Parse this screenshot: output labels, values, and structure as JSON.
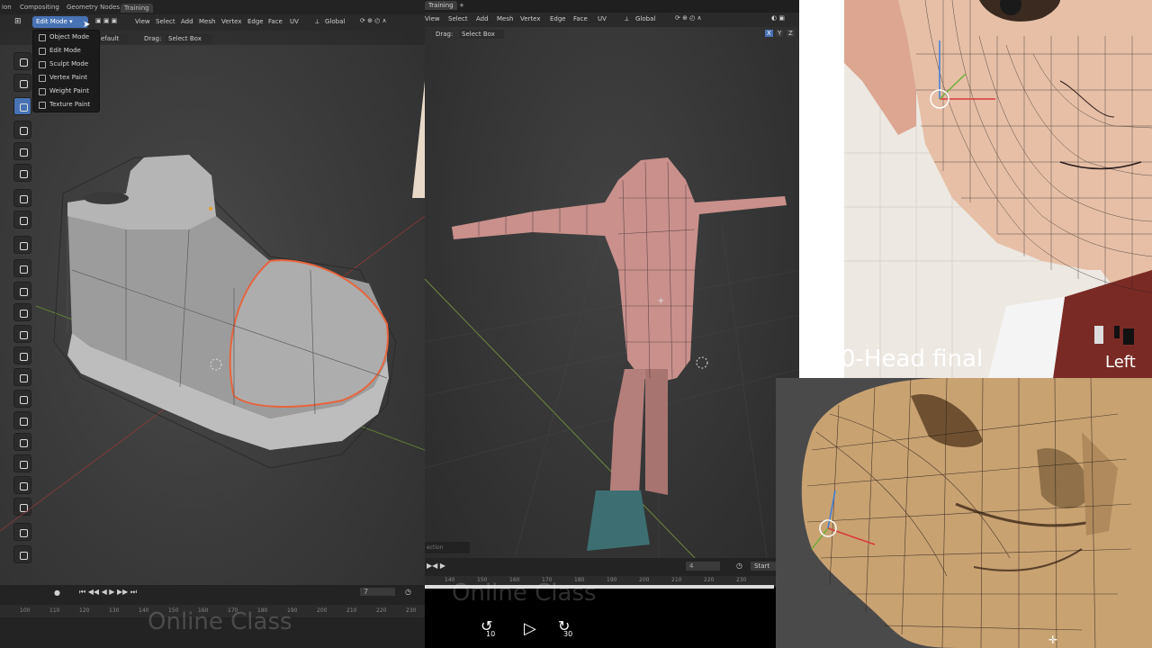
{
  "panel1": {
    "tabs": [
      "ion",
      "Compositing",
      "Geometry Nodes",
      "Training"
    ],
    "header": {
      "mode": "Edit Mode",
      "menus": [
        "View",
        "Select",
        "Add",
        "Mesh",
        "Vertex",
        "Edge",
        "Face",
        "UV"
      ],
      "orientation": "Global"
    },
    "header2": {
      "layer": "efault",
      "drag_label": "Drag:",
      "drag_value": "Select Box"
    },
    "mode_menu": [
      "Object Mode",
      "Edit Mode",
      "Sculpt Mode",
      "Vertex Paint",
      "Weight Paint",
      "Texture Paint"
    ],
    "timeline": {
      "frame": "7",
      "ruler": [
        "100",
        "110",
        "120",
        "130",
        "140",
        "150",
        "160",
        "170",
        "180",
        "190",
        "200",
        "210",
        "220",
        "230"
      ]
    },
    "watermark": "Online Class"
  },
  "panel2": {
    "tabs": [
      "Training",
      "+"
    ],
    "header": {
      "menus": [
        "View",
        "Select",
        "Add",
        "Mesh",
        "Vertex",
        "Edge",
        "Face",
        "UV"
      ],
      "orientation": "Global"
    },
    "header2": {
      "drag_label": "Drag:",
      "drag_value": "Select Box",
      "axes": [
        "X",
        "Y",
        "Z"
      ]
    },
    "timeline": {
      "status": "ection",
      "frame": "4",
      "start_label": "Start",
      "ruler": [
        "140",
        "150",
        "160",
        "170",
        "180",
        "190",
        "200",
        "210",
        "220",
        "230"
      ]
    },
    "watermark": "Online Class",
    "controls": {
      "rewind": "10",
      "forward": "30"
    }
  },
  "panel3": {
    "caption": "0-Head final",
    "view_label": "Left"
  },
  "colors": {
    "accent": "#4772b3",
    "selection": "#e8643c",
    "skin": "#c9908c",
    "tan": "#c9a272"
  }
}
